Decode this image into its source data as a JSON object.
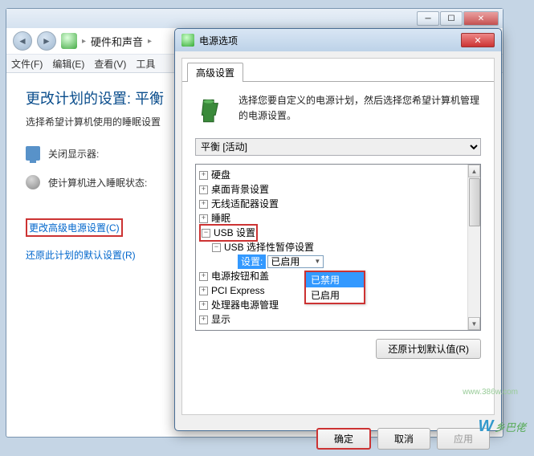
{
  "main": {
    "breadcrumb": {
      "item1": "硬件和声音",
      "sep": "▸"
    },
    "menu": {
      "file": "文件(F)",
      "edit": "编辑(E)",
      "view": "查看(V)",
      "tools": "工具"
    },
    "title": "更改计划的设置: 平衡",
    "desc": "选择希望计算机使用的睡眠设置",
    "row1": "关闭显示器:",
    "row2": "使计算机进入睡眠状态:",
    "link_advanced": "更改高级电源设置(C)",
    "link_restore": "还原此计划的默认设置(R)"
  },
  "dialog": {
    "title": "电源选项",
    "tab": "高级设置",
    "desc": "选择您要自定义的电源计划，然后选择您希望计算机管理的电源设置。",
    "plan": "平衡 [活动]",
    "tree": {
      "hdd": "硬盘",
      "bg": "桌面背景设置",
      "wifi": "无线适配器设置",
      "sleep": "睡眠",
      "usb": "USB 设置",
      "usb_sub": "USB 选择性暂停设置",
      "setting_label": "设置:",
      "setting_value": "已启用",
      "dropdown_disabled": "已禁用",
      "dropdown_enabled": "已启用",
      "power_btn": "电源按钮和盖",
      "pci": "PCI Express",
      "cpu": "处理器电源管理",
      "display": "显示"
    },
    "restore_btn": "还原计划默认值(R)",
    "ok": "确定",
    "cancel": "取消",
    "apply": "应用"
  },
  "watermark": {
    "url": "www.386w.com",
    "text": "乡巴佬"
  }
}
